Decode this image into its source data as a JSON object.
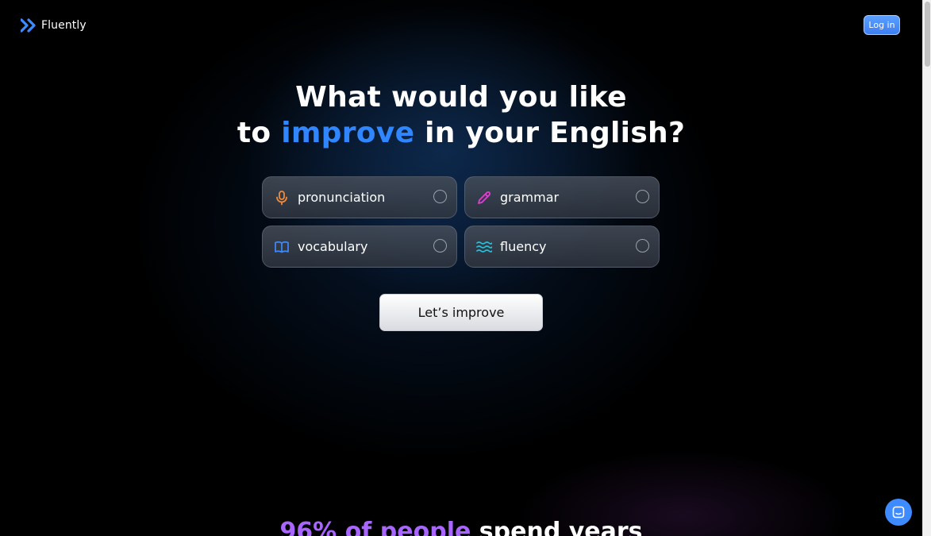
{
  "brand": {
    "name": "Fluently",
    "accent_color": "#3d8bff"
  },
  "header": {
    "login_label": "Log in"
  },
  "hero": {
    "line1": "What would you like",
    "line2_prefix": "to ",
    "line2_accent": "improve",
    "line2_suffix": " in your English?",
    "accent_color": "#2f86ff"
  },
  "options": [
    {
      "label": "pronunciation",
      "icon": "microphone-icon",
      "icon_color": "#f08a3c",
      "selected": false
    },
    {
      "label": "grammar",
      "icon": "pencil-icon",
      "icon_color": "#e040d0",
      "selected": false
    },
    {
      "label": "vocabulary",
      "icon": "book-icon",
      "icon_color": "#3d8bff",
      "selected": false
    },
    {
      "label": "fluency",
      "icon": "waves-icon",
      "icon_color": "#22c3dd",
      "selected": false
    }
  ],
  "cta": {
    "label": "Let’s improve"
  },
  "section2": {
    "accent": "96% of people",
    "rest": " spend years",
    "accent_color": "#a866ff"
  },
  "chat": {
    "icon": "chat-icon"
  }
}
